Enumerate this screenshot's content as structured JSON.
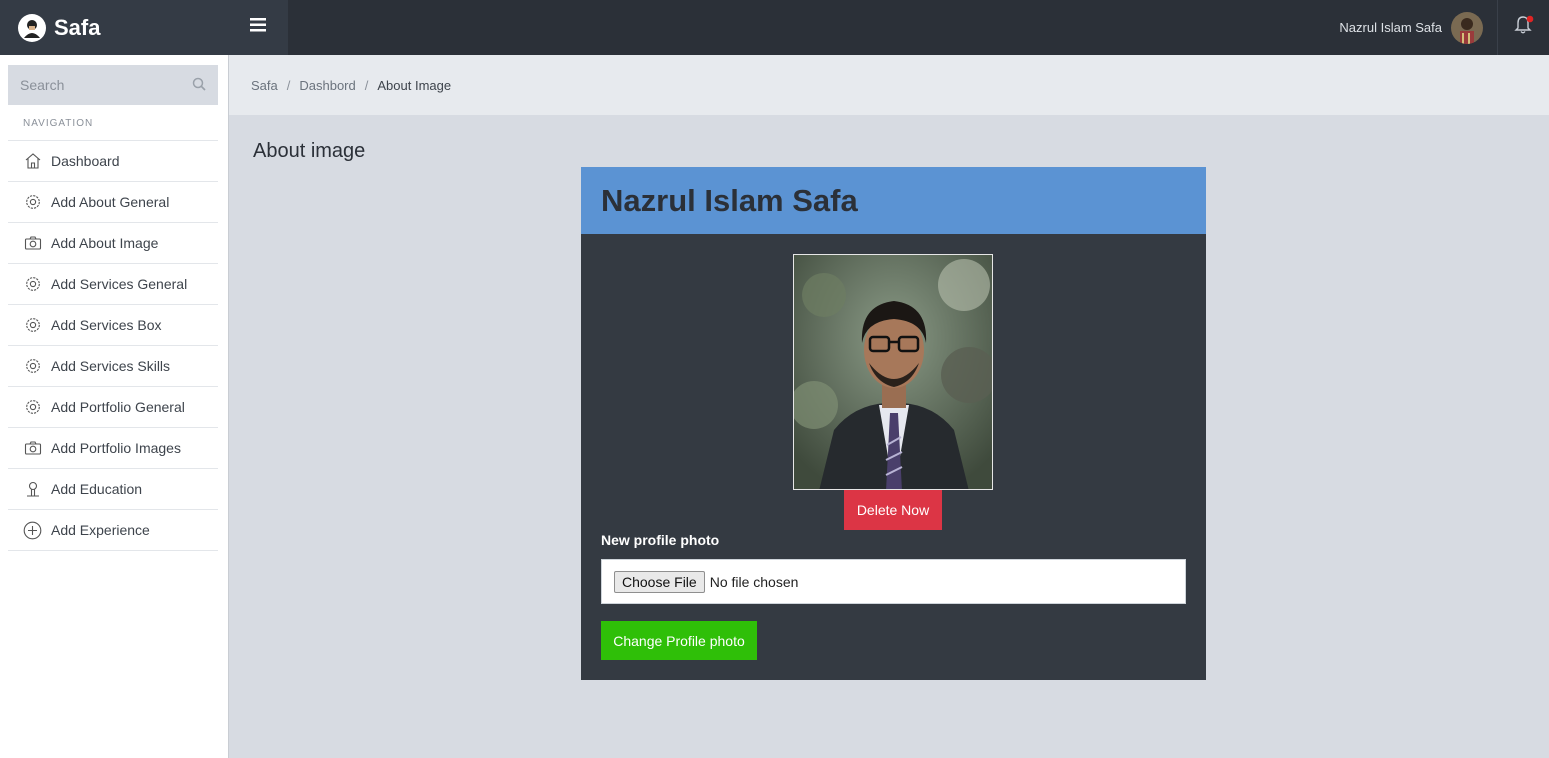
{
  "brand": {
    "name": "Safa",
    "logo_icon": "user-portrait-icon"
  },
  "header": {
    "user_name": "Nazrul Islam Safa",
    "accent_notification": "#e02424"
  },
  "sidebar": {
    "search_placeholder": "Search",
    "nav_heading": "NAVIGATION",
    "items": [
      {
        "label": "Dashboard",
        "icon": "home-icon"
      },
      {
        "label": "Add About General",
        "icon": "gear-icon"
      },
      {
        "label": "Add About Image",
        "icon": "camera-icon"
      },
      {
        "label": "Add Services General",
        "icon": "gear-icon"
      },
      {
        "label": "Add Services Box",
        "icon": "gear-icon"
      },
      {
        "label": "Add Services Skills",
        "icon": "gear-icon"
      },
      {
        "label": "Add Portfolio General",
        "icon": "gear-icon"
      },
      {
        "label": "Add Portfolio Images",
        "icon": "camera-icon"
      },
      {
        "label": "Add Education",
        "icon": "person-icon"
      },
      {
        "label": "Add Experience",
        "icon": "plus-circle-icon"
      }
    ]
  },
  "breadcrumb": {
    "items": [
      "Safa",
      "Dashbord"
    ],
    "current": "About Image"
  },
  "main": {
    "page_title": "About image",
    "card": {
      "title": "Nazrul Islam Safa",
      "header_color": "#5b93d3",
      "delete_label": "Delete Now",
      "field_label": "New profile photo",
      "file_button_label": "Choose File",
      "file_status": "No file chosen",
      "submit_label": "Change Profile photo"
    }
  }
}
